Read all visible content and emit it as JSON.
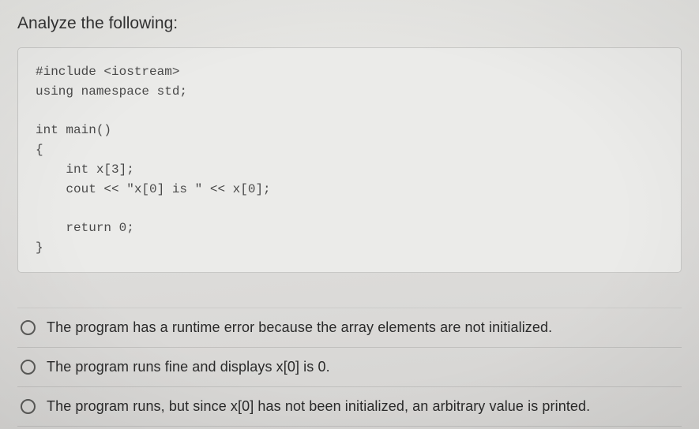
{
  "prompt": "Analyze the following:",
  "code": "#include <iostream>\nusing namespace std;\n\nint main()\n{\n    int x[3];\n    cout << \"x[0] is \" << x[0];\n\n    return 0;\n}",
  "options": [
    {
      "label": "The program has a runtime error because the array elements are not initialized."
    },
    {
      "label": "The program runs fine and displays x[0] is 0."
    },
    {
      "label": "The program runs, but since x[0] has not been initialized, an arbitrary value is printed."
    }
  ]
}
